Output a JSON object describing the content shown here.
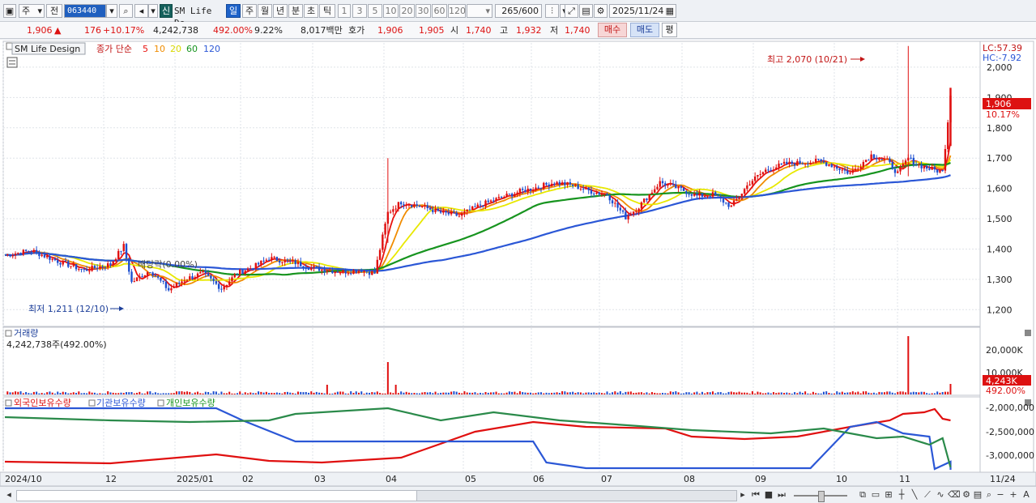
{
  "toolbar": {
    "market_type": "주",
    "prev_label": "전",
    "stock_code": "063440",
    "new_badge": "신",
    "stock_name": "SM Life De",
    "periods": [
      "일",
      "주",
      "월",
      "년",
      "분",
      "초",
      "틱"
    ],
    "active_period": "일",
    "intervals": [
      "1",
      "3",
      "5",
      "10",
      "20",
      "30",
      "60",
      "120"
    ],
    "count_display": "265/600",
    "date": "2025/11/24"
  },
  "quote": {
    "price": "1,906",
    "change": "176 ▲",
    "change_value": "176",
    "change_pct": "+10.17%",
    "volume": "4,242,738",
    "volume_ratio": "492.00%",
    "turnover": "9.22%",
    "amount": "8,017백만",
    "bid_label": "호가",
    "bid": "1,906",
    "ask": "1,905",
    "open_label": "시",
    "open": "1,740",
    "high_label": "고",
    "high": "1,932",
    "low_label": "저",
    "low": "1,740",
    "buy_label": "매수",
    "sell_label": "매도",
    "flat_label": "평"
  },
  "chart_data": {
    "type": "candlestick",
    "title": "SM Life Design",
    "ma_legend": {
      "label": "종가 단순",
      "periods": [
        "5",
        "10",
        "20",
        "60",
        "120"
      ],
      "colors": [
        "#e8130f",
        "#f08c00",
        "#e8e800",
        "#17941f",
        "#2b57d6"
      ]
    },
    "price_axis": {
      "ticks": [
        "2,000",
        "1,900",
        "1,800",
        "1,700",
        "1,600",
        "1,500",
        "1,400",
        "1,300",
        "1,200"
      ],
      "min": 1150,
      "max": 2080
    },
    "lc_label": "LC:57.39",
    "hc_label": "HC:-7.92",
    "last_price_tag": "1,906",
    "last_change_tag": "10.17%",
    "high_annotation": "최고 2,070 (10/21)",
    "low_annotation": "최저 1,211 (12/10)",
    "dividend_annotation": "배당락(0.00%)",
    "volume_panel": {
      "title": "거래량",
      "info": "4,242,738주(492.00%)",
      "ticks": [
        "20,000K",
        "10,000K"
      ],
      "last_tag": "4,243K",
      "last_pct": "492.00%"
    },
    "holding_panel": {
      "legend": [
        "외국인보유수량",
        "기관보유수량",
        "개인보유수량"
      ],
      "ticks": [
        "-2,000,000",
        "-2,500,000",
        "-3,000,000"
      ]
    },
    "x_axis": [
      "2024/10",
      "12",
      "2025/01",
      "02",
      "03",
      "04",
      "05",
      "06",
      "07",
      "08",
      "09",
      "10",
      "11"
    ],
    "x_axis_right": "11/24",
    "series": {
      "close_points": [
        [
          0,
          1380
        ],
        [
          10,
          1395
        ],
        [
          20,
          1360
        ],
        [
          30,
          1330
        ],
        [
          40,
          1350
        ],
        [
          45,
          1410
        ],
        [
          48,
          1290
        ],
        [
          55,
          1330
        ],
        [
          62,
          1265
        ],
        [
          68,
          1300
        ],
        [
          75,
          1320
        ],
        [
          82,
          1270
        ],
        [
          88,
          1320
        ],
        [
          95,
          1345
        ],
        [
          100,
          1370
        ],
        [
          110,
          1355
        ],
        [
          115,
          1340
        ],
        [
          122,
          1330
        ],
        [
          128,
          1325
        ],
        [
          135,
          1330
        ],
        [
          140,
          1320
        ],
        [
          145,
          1520
        ],
        [
          150,
          1555
        ],
        [
          158,
          1540
        ],
        [
          165,
          1520
        ],
        [
          172,
          1510
        ],
        [
          180,
          1545
        ],
        [
          188,
          1570
        ],
        [
          195,
          1590
        ],
        [
          200,
          1600
        ],
        [
          208,
          1620
        ],
        [
          215,
          1610
        ],
        [
          222,
          1590
        ],
        [
          228,
          1580
        ],
        [
          235,
          1505
        ],
        [
          240,
          1540
        ],
        [
          248,
          1620
        ],
        [
          255,
          1600
        ],
        [
          262,
          1575
        ],
        [
          268,
          1580
        ],
        [
          275,
          1540
        ],
        [
          282,
          1620
        ],
        [
          288,
          1660
        ],
        [
          295,
          1680
        ],
        [
          302,
          1685
        ],
        [
          308,
          1690
        ],
        [
          312,
          1680
        ],
        [
          320,
          1650
        ],
        [
          328,
          1710
        ],
        [
          334,
          1690
        ],
        [
          338,
          1650
        ],
        [
          342,
          1700
        ],
        [
          345,
          1680
        ],
        [
          350,
          1665
        ],
        [
          355,
          1655
        ],
        [
          358,
          1906
        ]
      ]
    }
  },
  "status": {
    "icons": [
      "play",
      "first",
      "stop",
      "last",
      "zoom-out",
      "zoom-in",
      "text"
    ]
  }
}
